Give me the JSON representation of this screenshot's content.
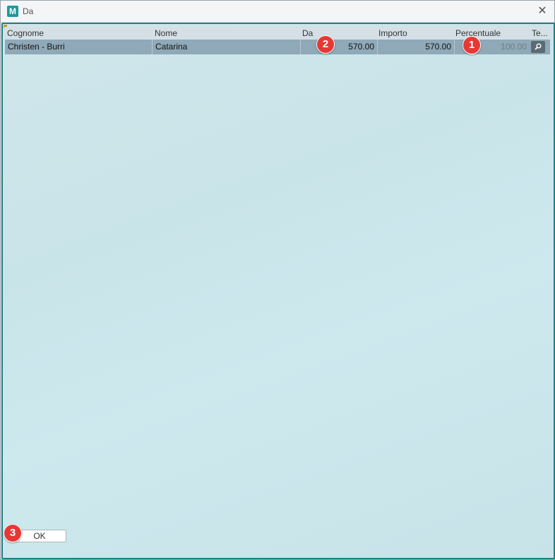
{
  "window": {
    "title": "Da",
    "app_icon_letter": "M",
    "close_glyph": "✕"
  },
  "table": {
    "columns": [
      "Cognome",
      "Nome",
      "Da",
      "Importo",
      "Percentuale",
      "Te..."
    ],
    "rows": [
      {
        "cognome": "Christen - Burri",
        "nome": "Catarina",
        "da": "570.00",
        "importo": "570.00",
        "percentuale": "100.00",
        "te_icon": "search-icon"
      }
    ]
  },
  "badges": [
    "1",
    "2",
    "3"
  ],
  "buttons": {
    "ok_label": "OK"
  },
  "colors": {
    "frame": "#1e7f85",
    "selected_row": "#8fa9b8",
    "badge": "#e53935",
    "app_icon": "#1c9a9c"
  }
}
